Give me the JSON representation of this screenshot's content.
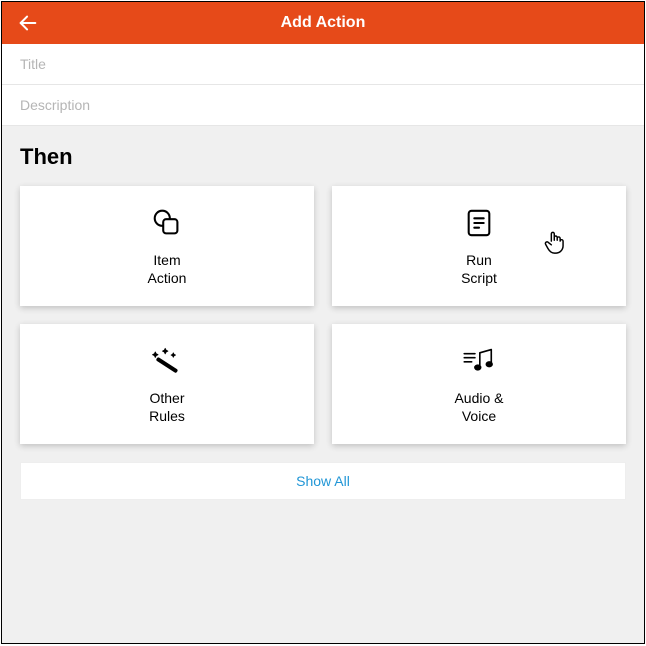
{
  "header": {
    "title": "Add Action",
    "back_icon": "back-arrow-icon"
  },
  "form": {
    "title_field": {
      "value": "",
      "placeholder": "Title"
    },
    "description_field": {
      "value": "",
      "placeholder": "Description"
    }
  },
  "section": {
    "label": "Then"
  },
  "cards": [
    {
      "id": "item-action",
      "icon": "copy-icon",
      "label": "Item\nAction"
    },
    {
      "id": "run-script",
      "icon": "script-icon",
      "label": "Run\nScript"
    },
    {
      "id": "other-rules",
      "icon": "wand-icon",
      "label": "Other\nRules"
    },
    {
      "id": "audio-voice",
      "icon": "music-icon",
      "label": "Audio &\nVoice"
    }
  ],
  "show_all": {
    "label": "Show All"
  },
  "colors": {
    "accent": "#e64a19",
    "link": "#2196d6"
  }
}
